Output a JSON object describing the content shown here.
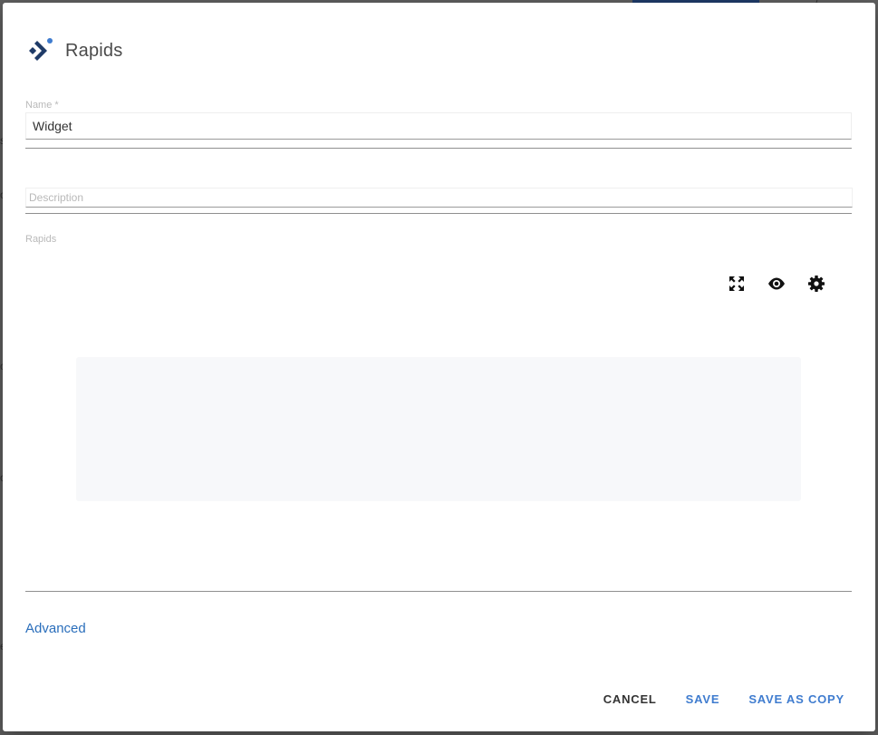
{
  "background": {
    "color": "#5f5f5f",
    "accent_tab_color": "#1f3b68",
    "glyphs": [
      "s",
      "o",
      "c",
      "o",
      "e",
      "/"
    ]
  },
  "dialog": {
    "title": "Rapids",
    "logo_icon": "rapids-logo-icon",
    "brand_color": "#1f3b68",
    "accent_dot_color": "#3f7ccf"
  },
  "form": {
    "name": {
      "label": "Name *",
      "value": "Widget"
    },
    "description": {
      "placeholder": "Description",
      "value": ""
    },
    "rapids": {
      "label": "Rapids"
    }
  },
  "toolbar": {
    "items": [
      {
        "name": "fullscreen-icon",
        "icon": "arrows-expand"
      },
      {
        "name": "preview-icon",
        "icon": "eye"
      },
      {
        "name": "settings-icon",
        "icon": "gear"
      }
    ]
  },
  "links": {
    "advanced": "Advanced"
  },
  "actions": {
    "cancel": "CANCEL",
    "save": "SAVE",
    "save_as_copy": "SAVE AS COPY"
  }
}
